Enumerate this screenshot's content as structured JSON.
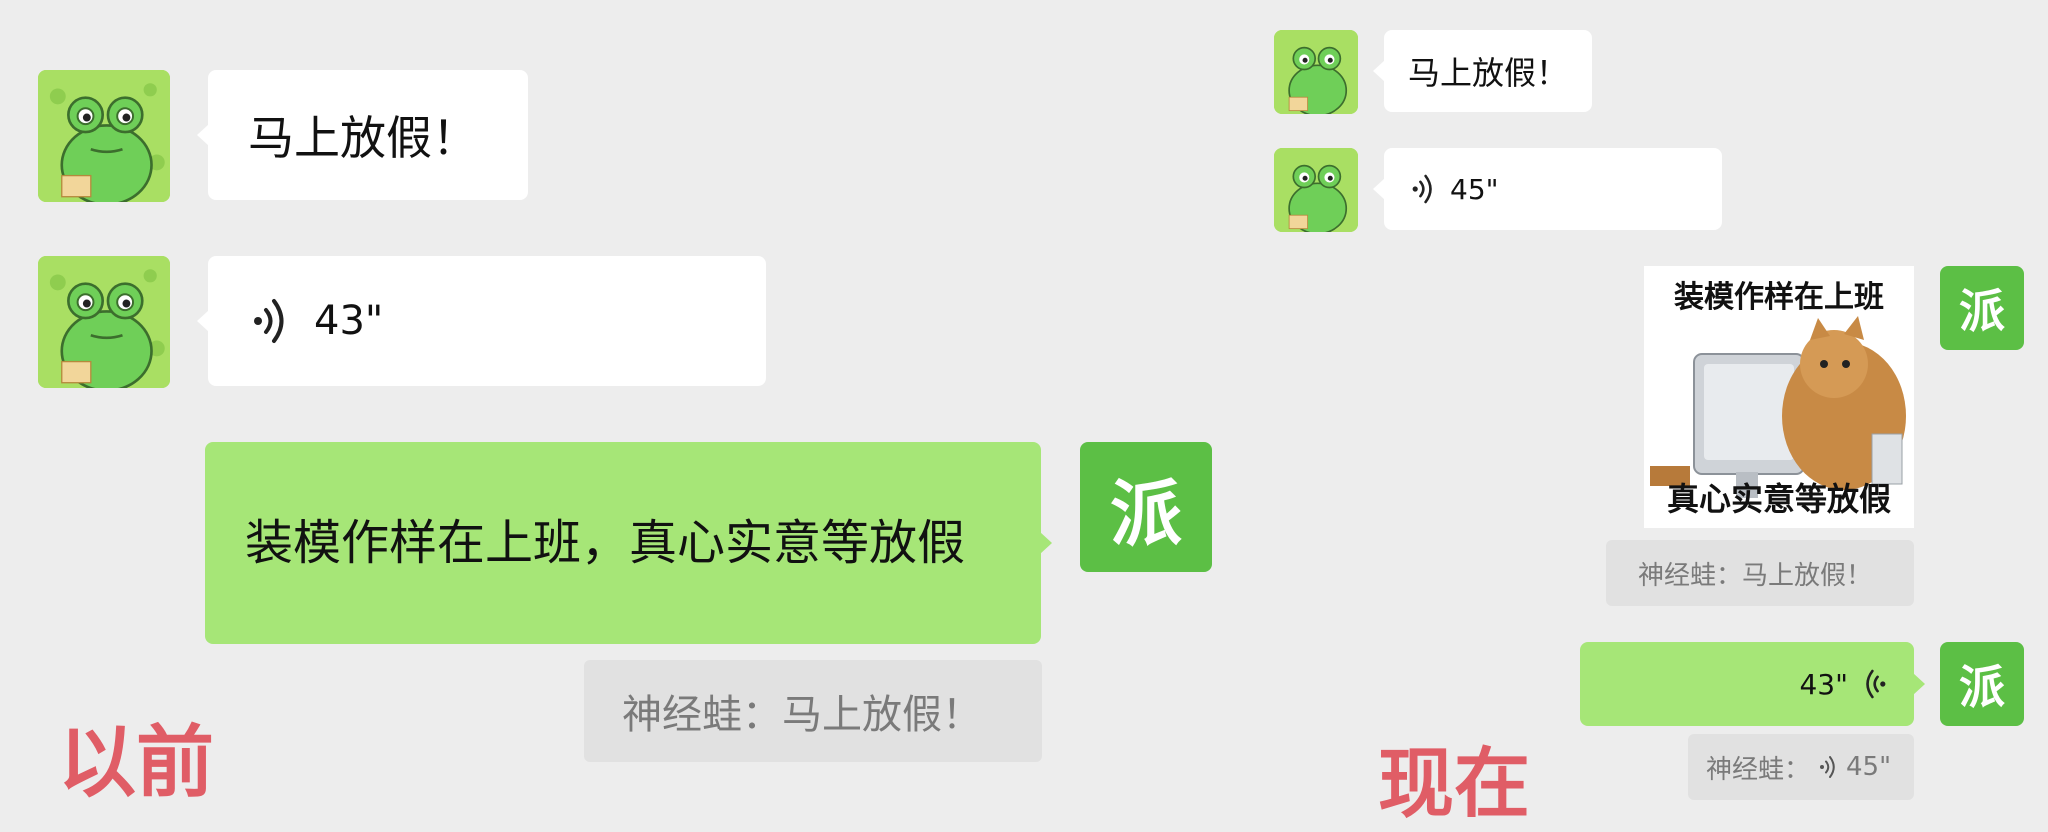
{
  "before": {
    "label": "以前",
    "msg1": "马上放假！",
    "voice_duration": "43\"",
    "my_reply": "装模作样在上班，真心实意等放假",
    "quote": "神经蛙：马上放假！"
  },
  "now": {
    "label": "现在",
    "msg1": "马上放假！",
    "voice_duration": "45\"",
    "sticker_top": "装模作样在上班",
    "sticker_bottom": "真心实意等放假",
    "quote1": "神经蛙：马上放假！",
    "my_voice_duration": "43\"",
    "quote2_prefix": "神经蛙：",
    "quote2_duration": "45\""
  },
  "self_avatar_char": "派",
  "colors": {
    "background": "#ededed",
    "green_bubble": "#a6e677",
    "white_bubble": "#ffffff",
    "quote_bg": "#e1e1e1",
    "label_red": "#e05d66",
    "avatar_green": "#5cbf45"
  }
}
